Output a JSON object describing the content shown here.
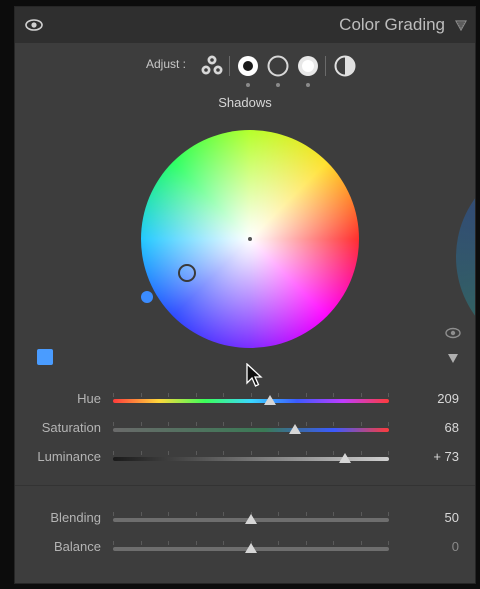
{
  "panel": {
    "title": "Color Grading",
    "adjust_label": "Adjust :",
    "region_label": "Shadows",
    "adjust_modes": [
      "3-way",
      "shadows",
      "midtones",
      "highlights",
      "global"
    ],
    "selected_mode": "shadows"
  },
  "wheel": {
    "hue": 209,
    "saturation": 68,
    "swatch_color": "#4a9cff"
  },
  "sliders": [
    {
      "label": "Hue",
      "value": "209",
      "level": 0.57
    },
    {
      "label": "Saturation",
      "value": "68",
      "level": 0.66
    },
    {
      "label": "Luminance",
      "value": "+ 73",
      "level": 0.84
    }
  ],
  "bottom_sliders": [
    {
      "label": "Blending",
      "value": "50",
      "level": 0.5
    },
    {
      "label": "Balance",
      "value": "0",
      "level": 0.5
    }
  ],
  "icons": {
    "visibility": "eye-icon",
    "collapse": "triangle-down-icon"
  }
}
